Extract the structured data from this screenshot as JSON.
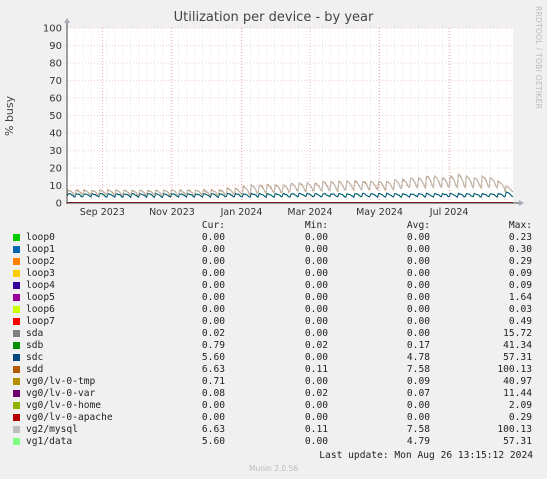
{
  "title": "Utilization per device - by year",
  "ylabel": "% busy",
  "side_credit": "RRDTOOL / TOBI OETIKER",
  "footer": "Munin 2.0.56",
  "last_update": "Last update: Mon Aug 26 13:15:12 2024",
  "legend_headers": {
    "cur": "Cur:",
    "min": "Min:",
    "avg": "Avg:",
    "max": "Max:"
  },
  "chart_data": {
    "type": "line",
    "title": "Utilization per device - by year",
    "ylabel": "% busy",
    "ylim": [
      0,
      100
    ],
    "yticks": [
      0,
      10,
      20,
      30,
      40,
      50,
      60,
      70,
      80,
      90,
      100
    ],
    "x_tick_labels": [
      "Sep 2023",
      "Nov 2023",
      "Jan 2024",
      "Mar 2024",
      "May 2024",
      "Jul 2024"
    ],
    "x_range": [
      "2023-08-01",
      "2024-08-26"
    ],
    "x_ticks": [
      "2023-09-01",
      "2023-11-01",
      "2024-01-01",
      "2024-03-01",
      "2024-05-01",
      "2024-07-01"
    ],
    "grid": true,
    "series": [
      {
        "name": "loop0",
        "color": "#00cc00",
        "cur": "0.00",
        "min": "0.00",
        "avg": "0.00",
        "max": "0.23"
      },
      {
        "name": "loop1",
        "color": "#0066b3",
        "cur": "0.00",
        "min": "0.00",
        "avg": "0.00",
        "max": "0.30"
      },
      {
        "name": "loop2",
        "color": "#ff8000",
        "cur": "0.00",
        "min": "0.00",
        "avg": "0.00",
        "max": "0.29"
      },
      {
        "name": "loop3",
        "color": "#ffcc00",
        "cur": "0.00",
        "min": "0.00",
        "avg": "0.00",
        "max": "0.09"
      },
      {
        "name": "loop4",
        "color": "#330099",
        "cur": "0.00",
        "min": "0.00",
        "avg": "0.00",
        "max": "0.09"
      },
      {
        "name": "loop5",
        "color": "#990099",
        "cur": "0.00",
        "min": "0.00",
        "avg": "0.00",
        "max": "1.64"
      },
      {
        "name": "loop6",
        "color": "#ccff00",
        "cur": "0.00",
        "min": "0.00",
        "avg": "0.00",
        "max": "0.03"
      },
      {
        "name": "loop7",
        "color": "#ff0000",
        "cur": "0.00",
        "min": "0.00",
        "avg": "0.00",
        "max": "0.49"
      },
      {
        "name": "sda",
        "color": "#808080",
        "cur": "0.02",
        "min": "0.00",
        "avg": "0.00",
        "max": "15.72"
      },
      {
        "name": "sdb",
        "color": "#008f00",
        "cur": "0.79",
        "min": "0.02",
        "avg": "0.17",
        "max": "41.34"
      },
      {
        "name": "sdc",
        "color": "#00487d",
        "cur": "5.60",
        "min": "0.00",
        "avg": "4.78",
        "max": "57.31"
      },
      {
        "name": "sdd",
        "color": "#b35a00",
        "cur": "6.63",
        "min": "0.11",
        "avg": "7.58",
        "max": "100.13"
      },
      {
        "name": "vg0/lv-0-tmp",
        "color": "#b38f00",
        "cur": "0.71",
        "min": "0.00",
        "avg": "0.09",
        "max": "40.97"
      },
      {
        "name": "vg0/lv-0-var",
        "color": "#6b006b",
        "cur": "0.08",
        "min": "0.02",
        "avg": "0.07",
        "max": "11.44"
      },
      {
        "name": "vg0/lv-0-home",
        "color": "#8fb300",
        "cur": "0.00",
        "min": "0.00",
        "avg": "0.00",
        "max": "2.09"
      },
      {
        "name": "vg0/lv-0-apache",
        "color": "#b30000",
        "cur": "0.00",
        "min": "0.00",
        "avg": "0.00",
        "max": "0.29"
      },
      {
        "name": "vg2/mysql",
        "color": "#bebebe",
        "cur": "6.63",
        "min": "0.11",
        "avg": "7.58",
        "max": "100.13"
      },
      {
        "name": "vg1/data",
        "color": "#80ff80",
        "cur": "5.60",
        "min": "0.00",
        "avg": "4.79",
        "max": "57.31"
      }
    ],
    "trend": {
      "vg2_mysql_weekly_range": [
        [
          4,
          7
        ],
        [
          4,
          7
        ],
        [
          4,
          7
        ],
        [
          4,
          7
        ],
        [
          4,
          7
        ],
        [
          4,
          7
        ],
        [
          4,
          7
        ],
        [
          4,
          7
        ],
        [
          4,
          7
        ],
        [
          4,
          7
        ],
        [
          4,
          7
        ],
        [
          4,
          7
        ],
        [
          4,
          7
        ],
        [
          4,
          7
        ],
        [
          4,
          7
        ],
        [
          4,
          7
        ],
        [
          4,
          7
        ],
        [
          4,
          7
        ],
        [
          4,
          7
        ],
        [
          4,
          7
        ],
        [
          4,
          8
        ],
        [
          4,
          8
        ],
        [
          4,
          9
        ],
        [
          4,
          10
        ],
        [
          5,
          10
        ],
        [
          5,
          10
        ],
        [
          5,
          10
        ],
        [
          5,
          10
        ],
        [
          6,
          11
        ],
        [
          6,
          11
        ],
        [
          6,
          11
        ],
        [
          6,
          11
        ],
        [
          6,
          12
        ],
        [
          6,
          12
        ],
        [
          6,
          12
        ],
        [
          7,
          12
        ],
        [
          7,
          12
        ],
        [
          7,
          12
        ],
        [
          7,
          12
        ],
        [
          7,
          12
        ],
        [
          7,
          12
        ],
        [
          7,
          13
        ],
        [
          8,
          13
        ],
        [
          8,
          14
        ],
        [
          8,
          14
        ],
        [
          8,
          15
        ],
        [
          8,
          15
        ],
        [
          8,
          14
        ],
        [
          8,
          15
        ],
        [
          8,
          16
        ],
        [
          8,
          15
        ],
        [
          8,
          14
        ],
        [
          8,
          15
        ],
        [
          8,
          14
        ],
        [
          8,
          12
        ],
        [
          6,
          9
        ]
      ],
      "vg1_data_weekly_range": [
        [
          3,
          5
        ],
        [
          3,
          5
        ],
        [
          3,
          5
        ],
        [
          3,
          5
        ],
        [
          3,
          5
        ],
        [
          3,
          5
        ],
        [
          3,
          5
        ],
        [
          3,
          5
        ],
        [
          3,
          5
        ],
        [
          3,
          5
        ],
        [
          3,
          5
        ],
        [
          3,
          5
        ],
        [
          3,
          5
        ],
        [
          3,
          5
        ],
        [
          3,
          5
        ],
        [
          3,
          5
        ],
        [
          3,
          5
        ],
        [
          3,
          5
        ],
        [
          3,
          5
        ],
        [
          3,
          5
        ],
        [
          3,
          5
        ],
        [
          3,
          5
        ],
        [
          3,
          5
        ],
        [
          3,
          5
        ],
        [
          3,
          5
        ],
        [
          3,
          5
        ],
        [
          3,
          5
        ],
        [
          3,
          5
        ],
        [
          3,
          5
        ],
        [
          3,
          5
        ],
        [
          3,
          5
        ],
        [
          3,
          5
        ],
        [
          3,
          5
        ],
        [
          3,
          5
        ],
        [
          3,
          5
        ],
        [
          3,
          5
        ],
        [
          3,
          5
        ],
        [
          3,
          5
        ],
        [
          3,
          5
        ],
        [
          3,
          5
        ],
        [
          3,
          5
        ],
        [
          3,
          5
        ],
        [
          3,
          5
        ],
        [
          3,
          5
        ],
        [
          3,
          5
        ],
        [
          3,
          5
        ],
        [
          3,
          5
        ],
        [
          3,
          5
        ],
        [
          3,
          5
        ],
        [
          3,
          5
        ],
        [
          3,
          5
        ],
        [
          3,
          5
        ],
        [
          3,
          5
        ],
        [
          3,
          5
        ],
        [
          3,
          5
        ],
        [
          3,
          6
        ]
      ]
    }
  }
}
